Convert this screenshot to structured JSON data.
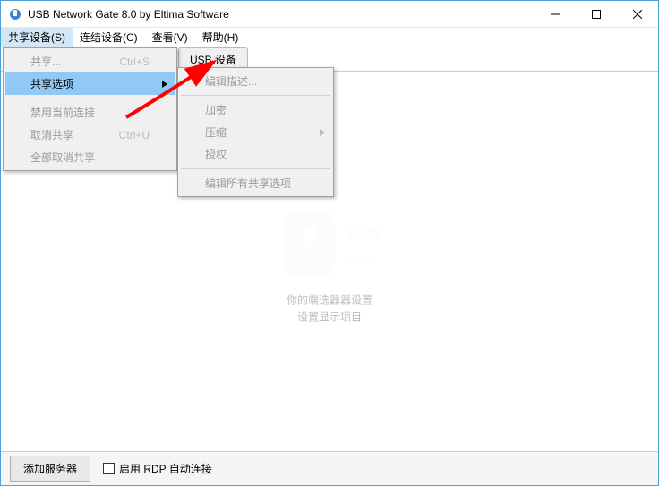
{
  "titlebar": {
    "title": "USB Network Gate 8.0 by Eltima Software"
  },
  "menubar": {
    "items": {
      "share": "共享设备(S)",
      "connect": "连结设备(C)",
      "view": "查看(V)",
      "help": "帮助(H)"
    }
  },
  "tabs": {
    "remote": "USB 设备"
  },
  "menu1": {
    "share": {
      "label": "共享...",
      "shortcut": "Ctrl+S"
    },
    "options": {
      "label": "共享选项"
    },
    "disable": {
      "label": "禁用当前连接"
    },
    "unshare": {
      "label": "取消共享",
      "shortcut": "Ctrl+U"
    },
    "unshare_all": {
      "label": "全部取消共享"
    }
  },
  "menu2": {
    "edit_desc": "编辑描述...",
    "encrypt": "加密",
    "compress": "压缩",
    "auth": "授权",
    "edit_all": "编辑所有共享选项"
  },
  "empty_state": {
    "line1": "你的端选器器设置",
    "line2": "设置显示项目"
  },
  "statusbar": {
    "add_server": "添加服务器",
    "rdp_auto": "启用 RDP 自动连接"
  }
}
